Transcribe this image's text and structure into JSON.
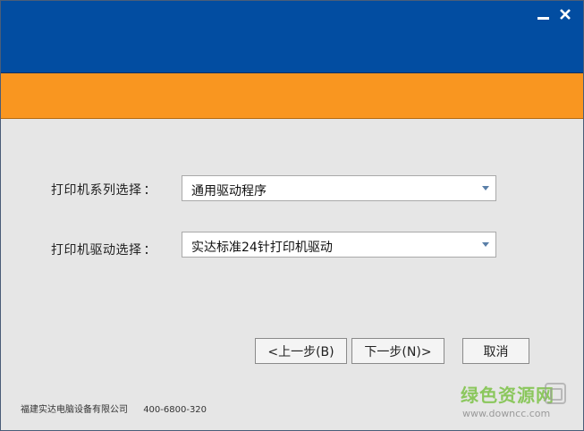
{
  "window": {
    "minimize_glyph": "—",
    "close_glyph": "✕"
  },
  "form": {
    "series_label": "打印机系列选择",
    "series_colon": "：",
    "series_value": "通用驱动程序",
    "driver_label": "打印机驱动选择",
    "driver_colon": "：",
    "driver_value": "实达标准24针打印机驱动"
  },
  "buttons": {
    "prev": "<上一步(B)",
    "next": "下一步(N)>",
    "cancel": "取消"
  },
  "footer": {
    "company": "福建实达电脑设备有限公司",
    "phone": "400-6800-320"
  },
  "watermark": {
    "brand": "绿色资源网",
    "url": "www.downcc.com"
  },
  "colors": {
    "titlebar": "#024da1",
    "accent_band": "#f99620",
    "body": "#e6e6e6"
  },
  "icons": {
    "minimize": "minimize-icon",
    "close": "close-icon",
    "dropdown": "dropdown-arrow-icon"
  }
}
